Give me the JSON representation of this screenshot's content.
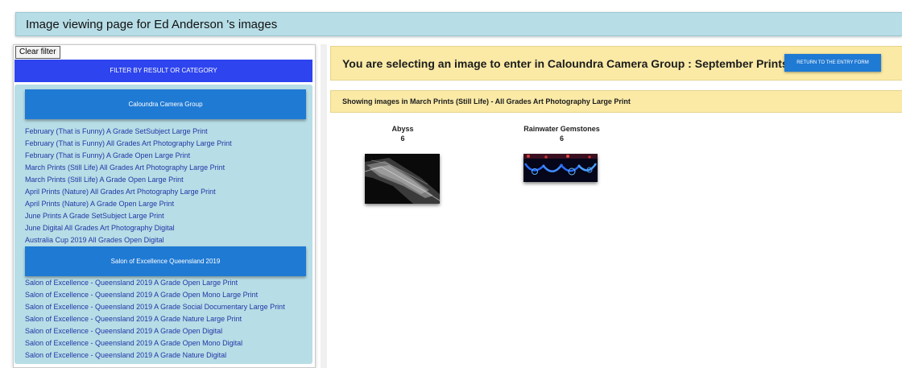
{
  "header": {
    "title": "Image viewing page for Ed Anderson 's images"
  },
  "sidebar": {
    "clear_filter_label": "Clear filter",
    "filter_heading": "FILTER BY RESULT OR CATEGORY",
    "groups": [
      {
        "name": "Caloundra Camera Group",
        "items": [
          "February (That is Funny) A Grade SetSubject Large Print",
          "February (That is Funny) All Grades Art Photography Large Print",
          "February (That is Funny) A Grade Open Large Print",
          "March Prints (Still Life) All Grades Art Photography Large Print",
          "March Prints (Still Life) A Grade Open Large Print",
          "April Prints (Nature) All Grades Art Photography Large Print",
          "April Prints (Nature) A Grade Open Large Print",
          "June Prints A Grade SetSubject Large Print",
          "June Digital All Grades Art Photography Digital",
          "Australia Cup 2019 All Grades Open Digital"
        ]
      },
      {
        "name": "Salon of Excellence Queensland 2019",
        "items": [
          "Salon of Excellence - Queensland 2019 A Grade Open Large Print",
          "Salon of Excellence - Queensland 2019 A Grade Open Mono Large Print",
          "Salon of Excellence - Queensland 2019 A Grade Social Documentary Large Print",
          "Salon of Excellence - Queensland 2019 A Grade Nature Large Print",
          "Salon of Excellence - Queensland 2019 A Grade Open Digital",
          "Salon of Excellence - Queensland 2019 A Grade Open Mono Digital",
          "Salon of Excellence - Queensland 2019 A Grade Nature Digital"
        ]
      }
    ]
  },
  "main": {
    "entry_banner": "You are selecting an image to enter in Caloundra Camera Group : September Prints",
    "return_button": "RETURN TO THE ENTRY FORM",
    "showing_text": "Showing images in March Prints (Still Life) - All Grades Art Photography Large Print",
    "images": [
      {
        "title": "Abyss",
        "score": "6"
      },
      {
        "title": "Rainwater Gemstones",
        "score": "6"
      }
    ]
  },
  "colors": {
    "header_bg": "#b7dde6",
    "filter_bar": "#2e44ee",
    "group_button": "#1f7ad4",
    "banner_bg": "#faeaa6",
    "link": "#2236a6"
  }
}
